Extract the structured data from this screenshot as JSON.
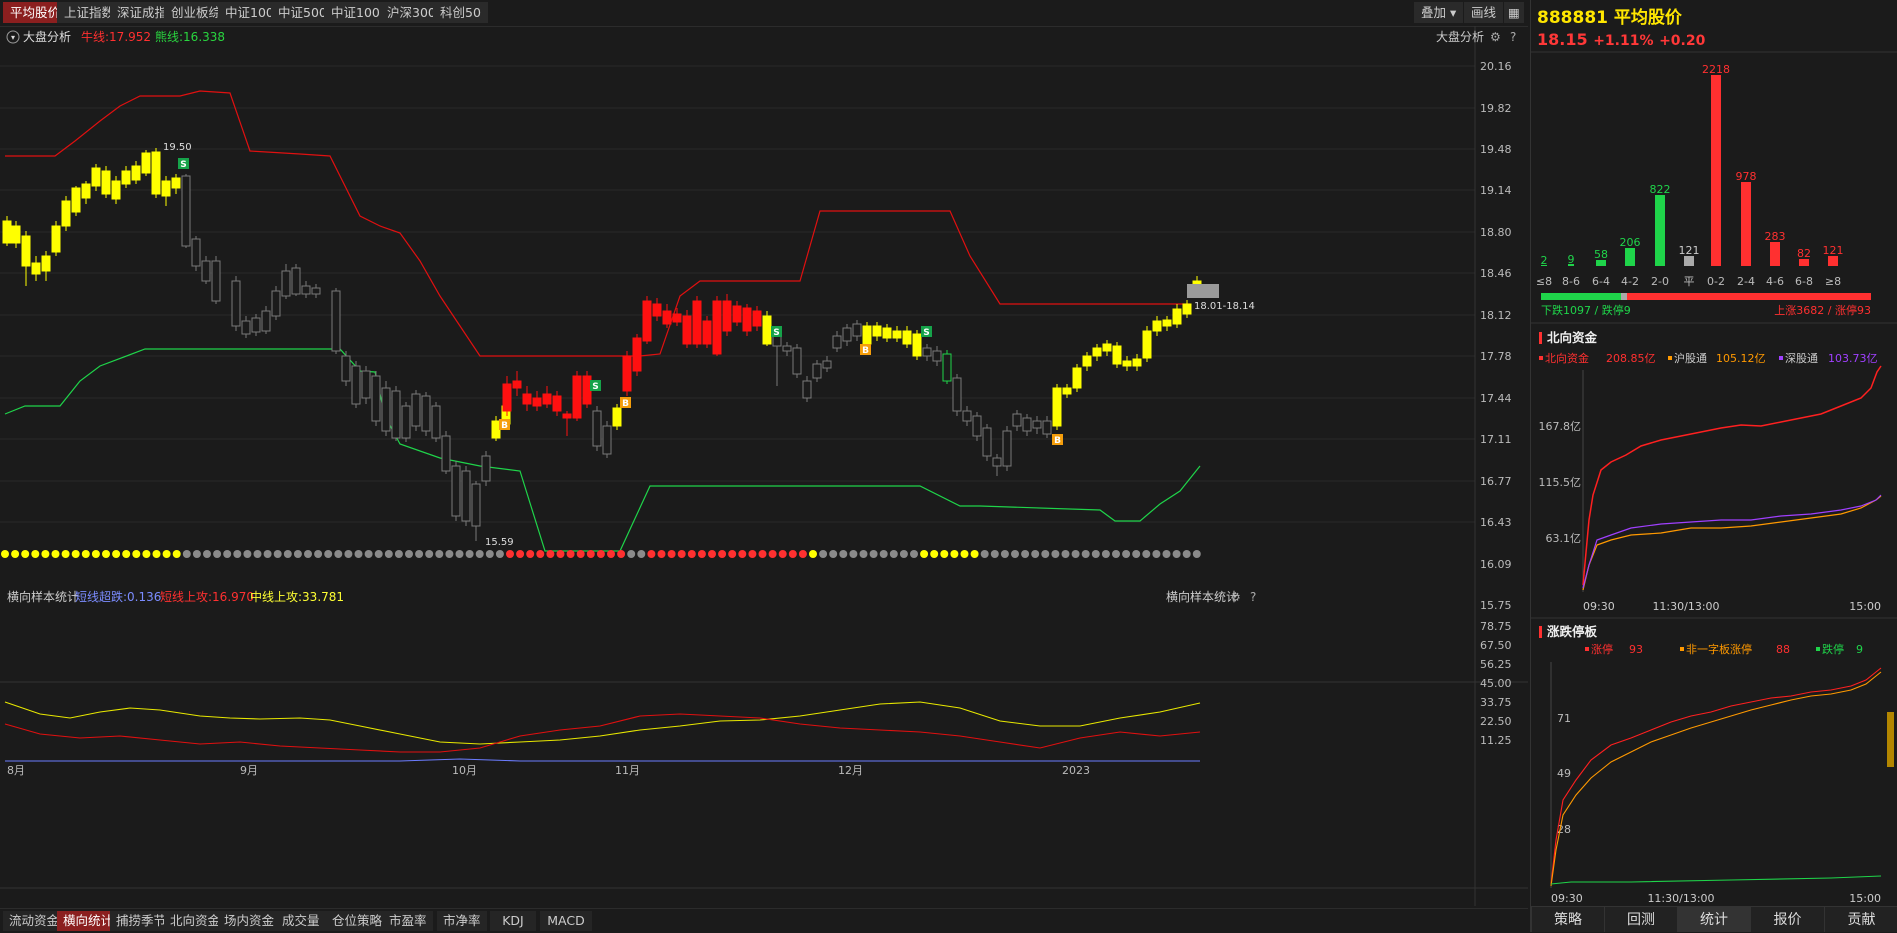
{
  "top_tabs": [
    "平均股价",
    "上证指数",
    "深证成指",
    "创业板综",
    "中证100",
    "中证500",
    "中证1000",
    "沪深300",
    "科创50"
  ],
  "top_right": {
    "overlay": "叠加",
    "draw": "画线"
  },
  "main": {
    "indicator_name": "大盘分析",
    "bull_label": "牛线:17.952",
    "bear_label": "熊线:16.338",
    "right_label": "大盘分析",
    "price_ticks": [
      "20.16",
      "19.82",
      "19.48",
      "19.14",
      "18.80",
      "18.46",
      "18.12",
      "17.78",
      "17.44",
      "17.11",
      "16.77",
      "16.43",
      "16.09",
      "15.75"
    ],
    "high_mark": "19.50",
    "low_mark": "15.59",
    "last_range": "18.01-18.14",
    "signal_S": "S",
    "signal_B": "B"
  },
  "sub": {
    "name": "横向样本统计",
    "short_oversold": "短线超跌:0.136",
    "short_up": "短线上攻:16.970",
    "mid_up": "中线上攻:33.781",
    "right_label": "横向样本统计",
    "ticks": [
      "78.75",
      "67.50",
      "56.25",
      "45.00",
      "33.75",
      "22.50",
      "11.25"
    ]
  },
  "x_ticks": [
    "8月",
    "9月",
    "10月",
    "11月",
    "12月",
    "2023"
  ],
  "bottom_tabs": [
    "流动资金",
    "横向统计",
    "捕捞季节",
    "北向资金",
    "场内资金",
    "成交量",
    "仓位策略",
    "市盈率",
    "市净率",
    "KDJ",
    "MACD"
  ],
  "stock": {
    "code": "888881",
    "name": "平均股价",
    "price": "18.15",
    "pct": "+1.11%",
    "chg": "+0.20"
  },
  "dist": {
    "values": [
      "2",
      "9",
      "58",
      "206",
      "822",
      "121",
      "2218",
      "978",
      "283",
      "82",
      "121"
    ],
    "labels": [
      "≤8",
      "8-6",
      "6-4",
      "4-2",
      "2-0",
      "平",
      "0-2",
      "2-4",
      "4-6",
      "6-8",
      "≥8"
    ],
    "down": "下跌1097 / 跌停9",
    "up": "上涨3682 / 涨停93"
  },
  "north": {
    "title": "北向资金",
    "legend1": "北向资金",
    "v1": "208.85亿",
    "legend2": "沪股通",
    "v2": "105.12亿",
    "legend3": "深股通",
    "v3": "103.73亿",
    "yticks": [
      "167.8亿",
      "115.5亿",
      "63.1亿"
    ],
    "xticks": [
      "09:30",
      "11:30/13:00",
      "15:00"
    ]
  },
  "limit": {
    "title": "涨跌停板",
    "legend1": "涨停",
    "v1": "93",
    "legend2": "非一字板涨停",
    "v2": "88",
    "legend3": "跌停",
    "v3": "9",
    "yticks": [
      "71",
      "49",
      "28"
    ],
    "xticks": [
      "09:30",
      "11:30/13:00",
      "15:00"
    ]
  },
  "right_tabs": [
    "策略",
    "回测",
    "统计",
    "报价",
    "贡献"
  ],
  "colors": {
    "up": "#ff2020",
    "down_yellow": "#ffff00",
    "gray": "#8a8a8a",
    "green": "#1fd44a",
    "accent": "#8b1f1f"
  }
}
